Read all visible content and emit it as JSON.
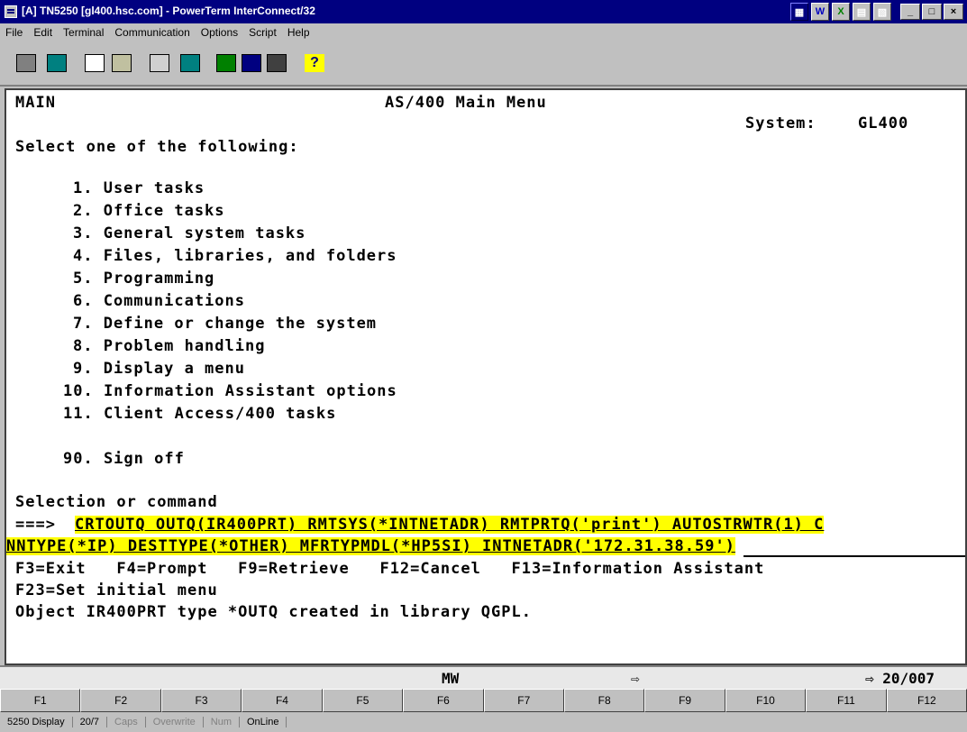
{
  "window": {
    "title": "[A] TN5250 [gl400.hsc.com] - PowerTerm InterConnect/32",
    "minimize": "_",
    "maximize": "□",
    "close": "×"
  },
  "menu": [
    "File",
    "Edit",
    "Terminal",
    "Communication",
    "Options",
    "Script",
    "Help"
  ],
  "terminal": {
    "screen_name": "MAIN",
    "screen_title": "AS/400 Main Menu",
    "system_label": "System:",
    "system_value": "GL400",
    "prompt": "Select one of the following:",
    "options": [
      "1. User tasks",
      "2. Office tasks",
      "3. General system tasks",
      "4. Files, libraries, and folders",
      "5. Programming",
      "6. Communications",
      "7. Define or change the system",
      "8. Problem handling",
      "9. Display a menu",
      "10. Information Assistant options",
      "11. Client Access/400 tasks",
      "90. Sign off"
    ],
    "selection_label": "Selection or command",
    "arrow": "===>",
    "command_line1": "CRTOUTQ OUTQ(IR400PRT) RMTSYS(*INTNETADR) RMTPRTQ('print') AUTOSTRWTR(1) C",
    "command_line2": "NNTYPE(*IP) DESTTYPE(*OTHER) MFRTYPMDL(*HP5SI) INTNETADR('172.31.38.59')",
    "fkeys_line1": "F3=Exit   F4=Prompt   F9=Retrieve   F12=Cancel   F13=Information Assistant",
    "fkeys_line2": "F23=Set initial menu",
    "message": "Object IR400PRT type *OUTQ created in library QGPL."
  },
  "status": {
    "mode": "MW",
    "arrow": "⇨",
    "position": "⇨ 20/007"
  },
  "fkeys": [
    "F1",
    "F2",
    "F3",
    "F4",
    "F5",
    "F6",
    "F7",
    "F8",
    "F9",
    "F10",
    "F11",
    "F12"
  ],
  "bottom": [
    "5250 Display",
    "20/7",
    "Caps",
    "Overwrite",
    "Num",
    "OnLine"
  ]
}
